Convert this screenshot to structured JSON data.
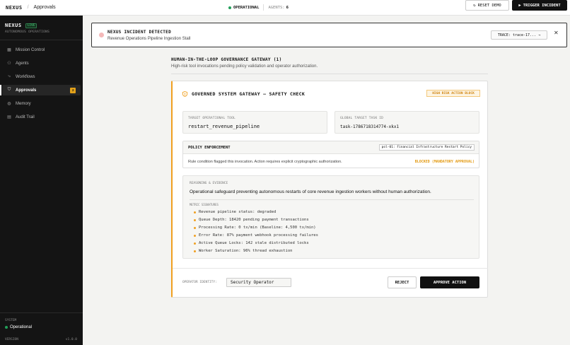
{
  "header": {
    "brand": "NEXUS",
    "breadcrumb": "Approvals",
    "status_label": "OPERATIONAL",
    "agents_label": "AGENTS:",
    "agents_count": "6",
    "reset_label": "RESET DEMO",
    "trigger_label": "TRIGGER INCIDENT"
  },
  "sidebar": {
    "brand": "NEXUS",
    "live_badge": "LIVE",
    "subtitle": "AUTONOMOUS OPERATIONS",
    "items": [
      {
        "label": "Mission Control",
        "icon": "grid-icon"
      },
      {
        "label": "Agents",
        "icon": "agents-icon"
      },
      {
        "label": "Workflows",
        "icon": "workflow-icon"
      },
      {
        "label": "Approvals",
        "icon": "shield-icon",
        "badge": "2",
        "active": true
      },
      {
        "label": "Memory",
        "icon": "memory-icon"
      },
      {
        "label": "Audit Trail",
        "icon": "document-icon"
      }
    ],
    "system_label": "SYSTEM",
    "system_status": "Operational",
    "version_label": "VERSION",
    "version_value": "v1.0.0"
  },
  "alert": {
    "title": "NEXUS INCIDENT DETECTED",
    "description": "Revenue Operations Pipeline Ingestion Stall",
    "trace_label": "TRACE: trace-17... →"
  },
  "gateway": {
    "title": "HUMAN-IN-THE-LOOP GOVERNANCE GATEWAY (1)",
    "subtitle": "High-risk tool invocations pending policy validation and operator authorization."
  },
  "card": {
    "title": "GOVERNED SYSTEM GATEWAY — SAFETY CHECK",
    "risk_badge": "HIGH RISK ACTION BLOCK",
    "tool_label": "TARGET OPERATIONAL TOOL",
    "tool_value": "restart_revenue_pipeline",
    "task_label": "GLOBAL TARGET TASK ID",
    "task_value": "task-1786718314774-xkx1",
    "policy": {
      "title": "POLICY ENFORCEMENT",
      "id": "pol-01: Financial Infrastructure Restart Policy",
      "text": "Rule condition flagged this invocation. Action requires explicit cryptographic authorization.",
      "status": "BLOCKED (MANDATORY APPROVAL)"
    },
    "reasoning": {
      "label": "REASONING & EVIDENCE",
      "text": "Operational safeguard preventing autonomous restarts of core revenue ingestion workers without human authorization.",
      "metrics_label": "METRIC SIGNATURES",
      "metrics": [
        "Revenue pipeline status: degraded",
        "Queue Depth: 18420 pending payment transactions",
        "Processing Rate: 0 tx/min (Baseline: 4,500 tx/min)",
        "Error Rate: 87% payment webhook processing failures",
        "Active Queue Locks: 142 stale distributed locks",
        "Worker Saturation: 96% thread exhaustion"
      ]
    },
    "operator_label": "OPERATOR IDENTITY:",
    "operator_value": "Security Operator",
    "reject_label": "REJECT",
    "approve_label": "APPROVE ACTION"
  },
  "colors": {
    "accent": "#f0a020",
    "status_green": "#22a05a",
    "sidebar_bg": "#141414"
  }
}
